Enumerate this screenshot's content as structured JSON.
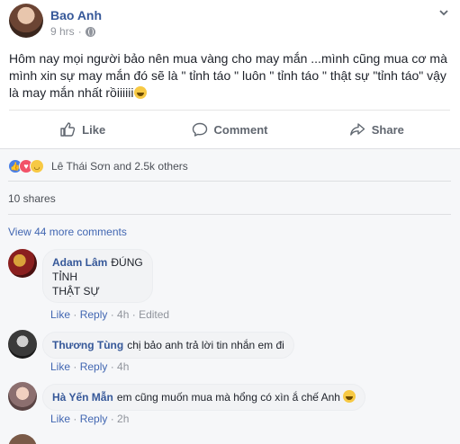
{
  "post": {
    "author": "Bao Anh",
    "time": "9 hrs",
    "dot": "·",
    "text": "Hôm nay mọi người bảo nên mua vàng cho may mắn ...mình cũng mua cơ mà mình xin sự may mắn đó sẽ là \" tỉnh táo \" luôn \" tỉnh táo \" thật sự \"tỉnh táo\" vậy là may mắn nhất rồiiiiii",
    "actions": {
      "like": "Like",
      "comment": "Comment",
      "share": "Share"
    }
  },
  "feedback": {
    "reactors": "Lê Thái Sơn and 2.5k others",
    "shares": "10 shares",
    "view_more": "View 44 more comments"
  },
  "comments": [
    {
      "name": "Adam Lâm",
      "lines": [
        "ĐÚNG",
        "TỈNH",
        "THẬT SỰ"
      ],
      "like": "Like",
      "reply": "Reply",
      "time": "4h",
      "edited": "Edited"
    },
    {
      "name": "Thương Tùng",
      "text": "chị bảo anh trả lời tin nhắn em đi",
      "like": "Like",
      "reply": "Reply",
      "time": "4h"
    },
    {
      "name": "Hà Yến Mẫn",
      "text": "em cũng muốn mua mà hổng có xìn ắ chế Anh",
      "like": "Like",
      "reply": "Reply",
      "time": "2h"
    }
  ],
  "colors": {
    "link": "#365899",
    "accent": "#4267b2",
    "muted": "#90949c",
    "like_reaction": "#4a7fe5",
    "love_reaction": "#f25268",
    "haha_reaction": "#f7c944"
  },
  "icons": {
    "like": "thumbs-up-icon",
    "comment": "speech-bubble-icon",
    "share": "share-arrow-icon",
    "privacy": "globe-icon",
    "menu": "chevron-down-icon",
    "emoji": "laughing-emoji-icon"
  }
}
